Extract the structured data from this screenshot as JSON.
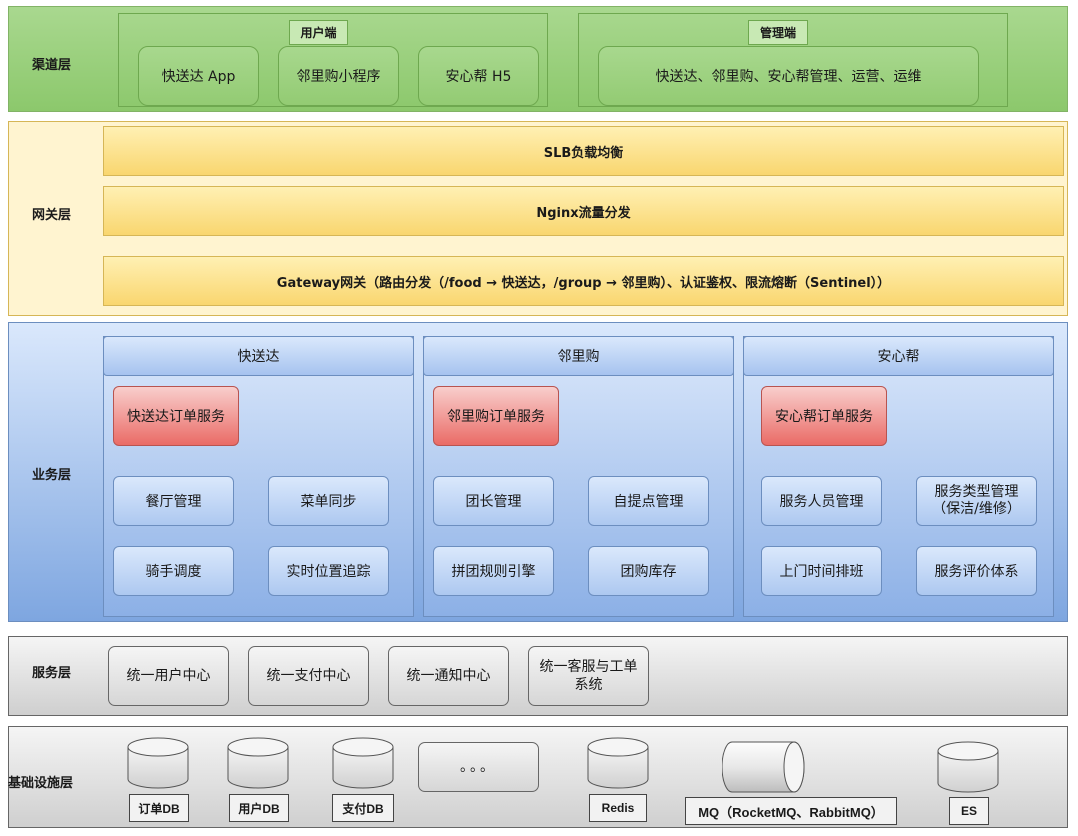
{
  "layers": {
    "channel": "渠道层",
    "gateway": "网关层",
    "business": "业务层",
    "service": "服务层",
    "infra": "基础设施层"
  },
  "channel": {
    "user_group": {
      "tag": "用户端",
      "items": [
        "快送达 App",
        "邻里购小程序",
        "安心帮 H5"
      ]
    },
    "admin_group": {
      "tag": "管理端",
      "item": "快送达、邻里购、安心帮管理、运营、运维"
    }
  },
  "gateway": {
    "slb": "SLB负载均衡",
    "nginx": "Nginx流量分发",
    "gw": "Gateway网关（路由分发（/food → 快送达，/group → 邻里购）、认证鉴权、限流熔断（Sentinel））"
  },
  "business": {
    "domains": [
      {
        "title": "快送达",
        "order": "快送达订单服务",
        "modules": [
          "餐厅管理",
          "菜单同步",
          "骑手调度",
          "实时位置追踪"
        ]
      },
      {
        "title": "邻里购",
        "order": "邻里购订单服务",
        "modules": [
          "团长管理",
          "自提点管理",
          "拼团规则引擎",
          "团购库存"
        ]
      },
      {
        "title": "安心帮",
        "order": "安心帮订单服务",
        "modules": [
          "服务人员管理",
          "服务类型管理（保洁/维修）",
          "上门时间排班",
          "服务评价体系"
        ]
      }
    ]
  },
  "service": {
    "items": [
      "统一用户中心",
      "统一支付中心",
      "统一通知中心",
      "统一客服与工单系统"
    ]
  },
  "infra": {
    "order_db": "订单DB",
    "user_db": "用户DB",
    "pay_db": "支付DB",
    "more": "。。。",
    "redis": "Redis",
    "mq": "MQ（RocketMQ、RabbitMQ）",
    "es": "ES"
  },
  "colors": {
    "channel": "#8cc86c",
    "gateway": "#fff4d0",
    "gateway_bar": "#f9d66f",
    "business": "#7ea6e0",
    "order_service": "#ea6b66",
    "service": "#cfcfcf"
  }
}
